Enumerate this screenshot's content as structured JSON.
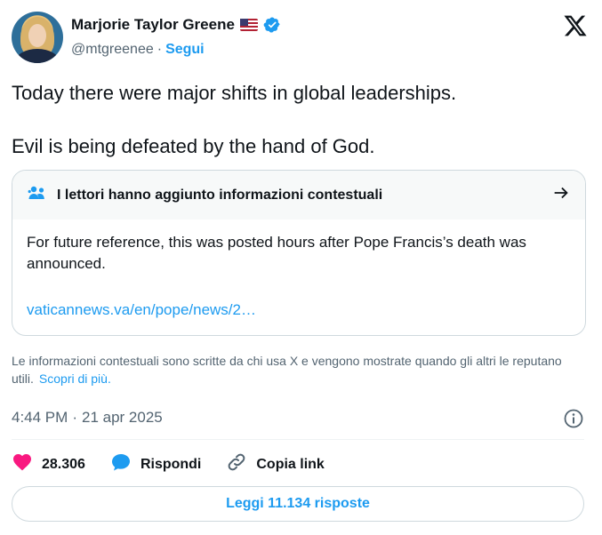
{
  "author": {
    "name": "Marjorie Taylor Greene",
    "handle": "@mtgreenee",
    "separator": "·",
    "follow_label": "Segui"
  },
  "icons": {
    "flag": "us-flag-emoji",
    "verified": "verified-badge-icon",
    "logo": "x-logo",
    "note_header": "people-icon",
    "note_arrow": "arrow-right-icon",
    "info": "info-icon",
    "like": "heart-icon",
    "reply": "speech-bubble-icon",
    "copy_link": "link-icon"
  },
  "tweet": {
    "paragraphs": [
      "Today there were major shifts in global leaderships.",
      "Evil is being defeated by the hand of God."
    ]
  },
  "community_note": {
    "title": "I lettori hanno aggiunto informazioni contestuali",
    "body": "For future reference, this was posted hours after Pope Francis’s death was announced.",
    "link": "vaticannews.va/en/pope/news/2…"
  },
  "disclaimer": {
    "text": "Le informazioni contestuali sono scritte da chi usa X e vengono mostrate quando gli altri le reputano utili.",
    "link_label": "Scopri di più."
  },
  "meta": {
    "time": "4:44 PM",
    "separator": "·",
    "date": "21 apr 2025"
  },
  "actions": {
    "likes": "28.306",
    "reply_label": "Rispondi",
    "copy_link_label": "Copia link"
  },
  "read_replies_label": "Leggi 11.134 risposte",
  "colors": {
    "accent": "#1d9bf0",
    "like": "#f91880",
    "secondary_text": "#536471",
    "note_header_icon": "#1d9bf0"
  }
}
